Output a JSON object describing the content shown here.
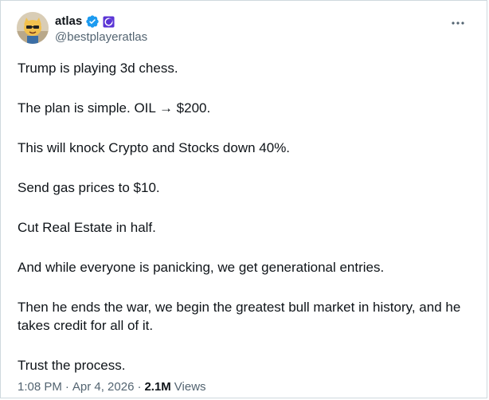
{
  "author": {
    "display_name": "atlas",
    "handle": "@bestplayeratlas",
    "avatar_icon": "cartoon-avatar",
    "verified_icon": "verified-badge-icon",
    "affiliation_icon": "affiliate-badge-icon",
    "verified_color": "#1d9bf0",
    "affiliation_color": "#5b35d5"
  },
  "more_icon": "more-options-icon",
  "tweet": {
    "paragraphs": [
      "Trump is playing 3d chess.",
      "The plan is simple. OIL → $200.",
      "This will knock Crypto and Stocks down 40%.",
      "Send gas prices to $10.",
      "Cut Real Estate in half.",
      "And while everyone is panicking, we get generational entries.",
      "Then he ends the war, we begin the greatest bull market in history, and he takes credit for all of it.",
      "Trust the process."
    ]
  },
  "meta": {
    "time": "1:08 PM",
    "separator": "·",
    "date": "Apr 4, 2026",
    "views_count": "2.1M",
    "views_label": "Views"
  },
  "colors": {
    "text": "#0f1419",
    "secondary": "#536471",
    "border": "#cfd9de"
  }
}
